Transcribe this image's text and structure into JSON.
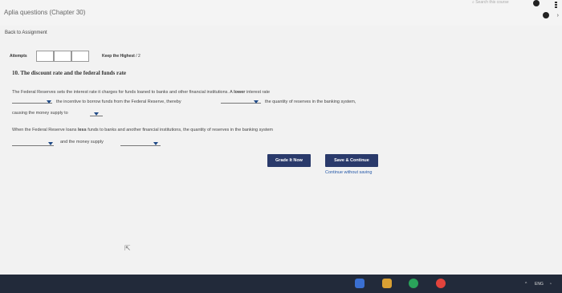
{
  "window": {
    "title": "Aplia questions (Chapter 30)",
    "search_placeholder": "Search this course"
  },
  "nav": {
    "back_label": "Back to Assignment"
  },
  "attempts": {
    "label": "Attempts",
    "keep_label": "Keep the Highest",
    "keep_score": "/ 2"
  },
  "question": {
    "number_title": "10. The discount rate and the federal funds rate",
    "p1_line1": "The Federal Reserves sets the interest rate it charges for funds loaned to banks and other financial institutions. A",
    "p1_bold": "lower",
    "p1_line1_end": "interest rate",
    "p1_line2a": "the incentive to borrow funds from the Federal Reserve, thereby",
    "p1_line2b": "the quantity of reserves in the banking system,",
    "p1_line3": "causing the money supply to",
    "p2_line1a": "When the Federal Reserve loans",
    "p2_bold": "less",
    "p2_line1b": "funds to banks and another financial institutions, the quantity of reserves in the banking system",
    "p2_line2": "and the money supply"
  },
  "actions": {
    "grade_label": "Grade It Now",
    "save_label": "Save & Continue",
    "continue_label": "Continue without saving"
  },
  "taskbar": {
    "lang": "ENG"
  },
  "colors": {
    "button_bg": "#2a3a6b",
    "link": "#2458a8",
    "caret": "#1f4a87"
  }
}
